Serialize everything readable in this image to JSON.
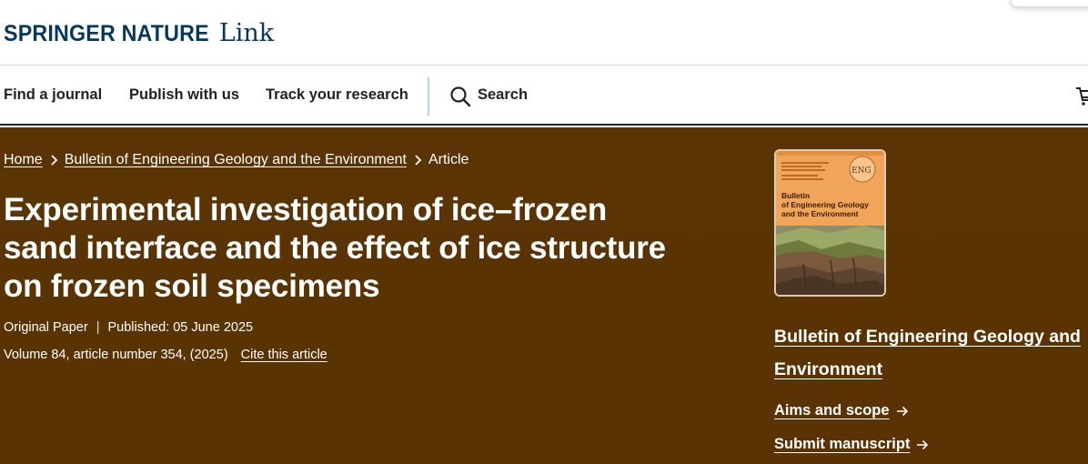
{
  "brand": {
    "name": "SPRINGER NATURE",
    "product": "Link"
  },
  "nav": {
    "items": [
      {
        "label": "Find a journal"
      },
      {
        "label": "Publish with us"
      },
      {
        "label": "Track your research"
      }
    ],
    "search_label": "Search"
  },
  "breadcrumb": {
    "home": "Home",
    "journal": "Bulletin of Engineering Geology and the Environment",
    "current": "Article"
  },
  "article": {
    "title_lines": [
      "Experimental investigation of ice–frozen",
      "sand interface and the effect of ice structure",
      "on frozen soil specimens"
    ],
    "type": "Original Paper",
    "published": "Published: 05 June 2025",
    "volume_info": "Volume 84, article number 354, (2025)",
    "cite_label": "Cite this article"
  },
  "journal": {
    "cover": {
      "title_lines": [
        "Bulletin",
        "of Engineering Geology",
        "and the Environment"
      ],
      "logo_text": "ENG"
    },
    "name_lines": [
      "Bulletin of Engineering Geology and",
      "Environment"
    ],
    "links": [
      {
        "label": "Aims and scope"
      },
      {
        "label": "Submit manuscript"
      }
    ]
  },
  "colors": {
    "brand": "#06375c",
    "hero_bg": "#5a3303",
    "nav_border": "#0a2d3f",
    "divider": "#b7d2e4",
    "cover_orange": "#f1a55a"
  },
  "icons": [
    "search-icon",
    "cart-icon",
    "chevron-right-icon",
    "arrow-right-icon"
  ]
}
